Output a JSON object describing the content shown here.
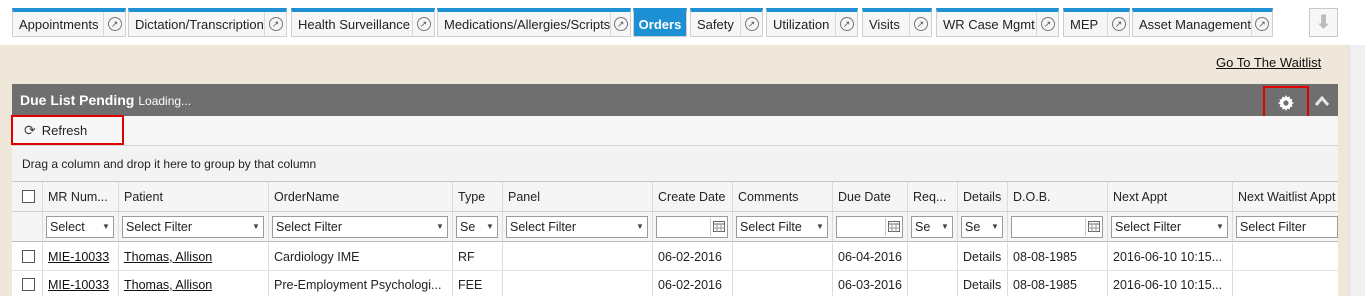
{
  "tabs": [
    {
      "label": "Appointments",
      "popout": true
    },
    {
      "label": "Dictation/Transcription",
      "popout": true
    },
    {
      "label": "Health Surveillance",
      "popout": true
    },
    {
      "label": "Medications/Allergies/Scripts",
      "popout": true
    },
    {
      "label": "Orders",
      "popout": false,
      "active": true
    },
    {
      "label": "Safety",
      "popout": true
    },
    {
      "label": "Utilization",
      "popout": true
    },
    {
      "label": "Visits",
      "popout": true
    },
    {
      "label": "WR Case Mgmt",
      "popout": true
    },
    {
      "label": "MEP",
      "popout": true
    },
    {
      "label": "Asset Management",
      "popout": true
    }
  ],
  "waitlist_link": "Go To The Waitlist",
  "panel": {
    "title": "Due List Pending",
    "status": "Loading..."
  },
  "toolbar": {
    "refresh_label": "Refresh"
  },
  "group_hint": "Drag a column and drop it here to group by that column",
  "columns": [
    "MR Num...",
    "Patient",
    "OrderName",
    "Type",
    "Panel",
    "Create Date",
    "Comments",
    "Due Date",
    "Req...",
    "Details",
    "D.O.B.",
    "Next Appt",
    "Next Waitlist Appt"
  ],
  "filters": [
    "Select",
    "Select Filter",
    "Select Filter",
    "Se",
    "Select Filter",
    "",
    "Select Filte",
    "",
    "Se",
    "Se",
    "",
    "Select Filter",
    "Select Filter"
  ],
  "rows": [
    [
      "MIE-10033",
      "Thomas, Allison",
      "Cardiology IME",
      "RF",
      "",
      "06-02-2016",
      "",
      "06-04-2016",
      "",
      "Details",
      "08-08-1985",
      "2016-06-10 10:15...",
      ""
    ],
    [
      "MIE-10033",
      "Thomas, Allison",
      "Pre-Employment Psychologi...",
      "FEE",
      "",
      "06-02-2016",
      "",
      "06-03-2016",
      "",
      "Details",
      "08-08-1985",
      "2016-06-10 10:15...",
      ""
    ]
  ],
  "colors": {
    "accent": "#1d8fd3",
    "panel_header": "#6f6f6f",
    "highlight_box": "#e00000"
  }
}
